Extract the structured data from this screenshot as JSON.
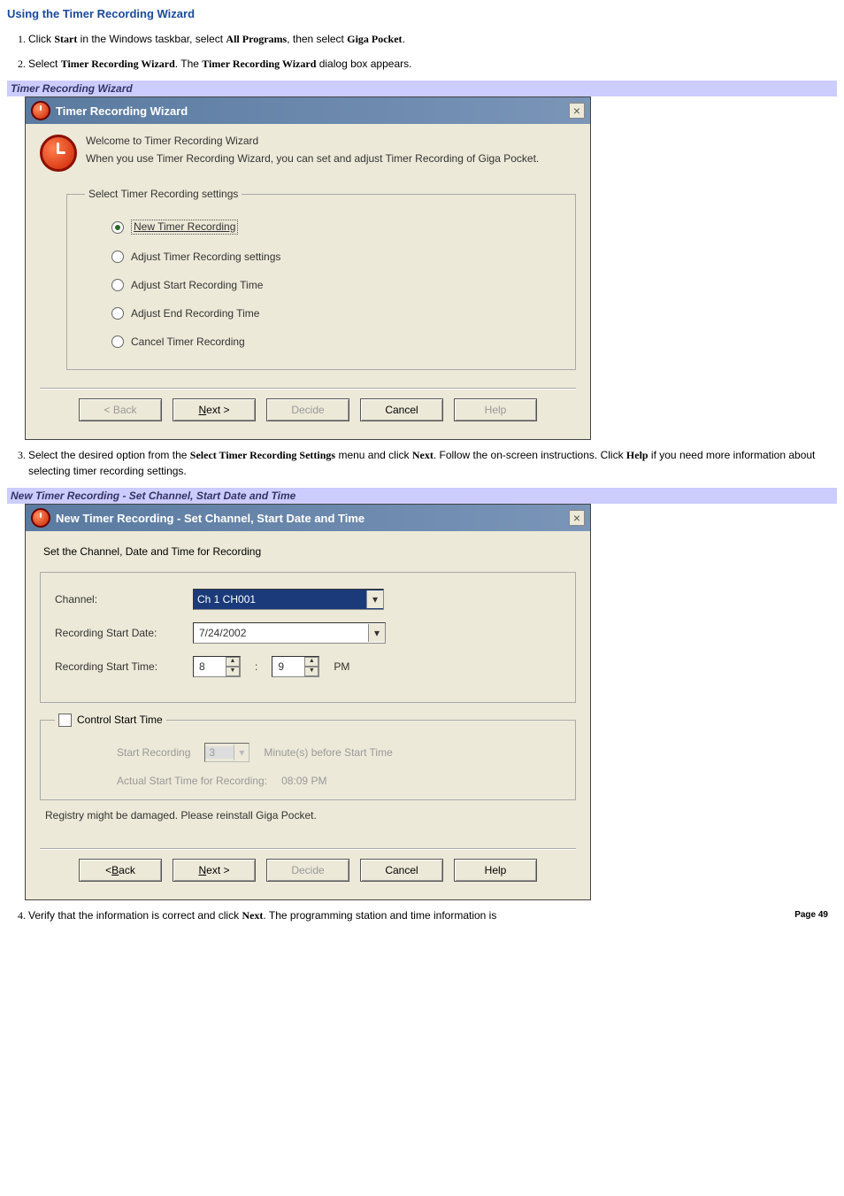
{
  "heading": "Using the Timer Recording Wizard",
  "steps": {
    "s1_a": "Click ",
    "s1_b": "Start",
    "s1_c": " in the Windows taskbar, select ",
    "s1_d": "All Programs",
    "s1_e": ", then select ",
    "s1_f": "Giga Pocket",
    "s1_g": ".",
    "s2_a": "Select ",
    "s2_b": "Timer Recording Wizard",
    "s2_c": ". The ",
    "s2_d": "Timer Recording Wizard",
    "s2_e": " dialog box appears.",
    "s3_a": "Select the desired option from the ",
    "s3_b": "Select Timer Recording Settings",
    "s3_c": " menu and click ",
    "s3_d": "Next",
    "s3_e": ". Follow the on-screen instructions. Click ",
    "s3_f": "Help",
    "s3_g": " if you need more information about selecting timer recording settings.",
    "s4_a": "Verify that the information is correct and click ",
    "s4_b": "Next",
    "s4_c": ". The programming station and time information is"
  },
  "caption1": "Timer Recording Wizard",
  "dialog1": {
    "title": "Timer Recording Wizard",
    "welcome1": "Welcome to Timer Recording Wizard",
    "welcome2": "When you use Timer Recording Wizard, you can set and adjust Timer Recording of Giga Pocket.",
    "group_legend": "Select Timer Recording settings",
    "opt1_u": "N",
    "opt1_rest": "ew Timer Recording",
    "opt2": "Adjust Timer Recording settings",
    "opt3": "Adjust Start Recording Time",
    "opt4": "Adjust End Recording Time",
    "opt5": "Cancel Timer Recording",
    "back": "< Back",
    "next_u": "N",
    "next_rest": "ext >",
    "decide": "Decide",
    "cancel": "Cancel",
    "help": "Help"
  },
  "caption2": "New Timer Recording - Set Channel, Start Date and Time",
  "dialog2": {
    "title": "New Timer Recording - Set Channel, Start Date and Time",
    "subtitle": "Set the Channel, Date and Time for Recording",
    "channel_label": "Channel:",
    "channel_value": "Ch 1 CH001",
    "date_label": "Recording Start Date:",
    "date_value": "7/24/2002",
    "time_label": "Recording Start Time:",
    "hour": "8",
    "minute": "9",
    "ampm": "PM",
    "cst_legend": "Control Start Time",
    "start_rec": "Start Recording",
    "min_val": "3",
    "min_after": "Minute(s) before Start Time",
    "actual_label": "Actual Start Time for Recording:",
    "actual_value": "08:09 PM",
    "status": "Registry might be damaged. Please reinstall Giga Pocket.",
    "back_u": "B",
    "back_pre": "< ",
    "back_rest": "ack",
    "next_u": "N",
    "next_rest": "ext >",
    "decide": "Decide",
    "cancel": "Cancel",
    "help": "Help"
  },
  "page_num": "Page 49"
}
